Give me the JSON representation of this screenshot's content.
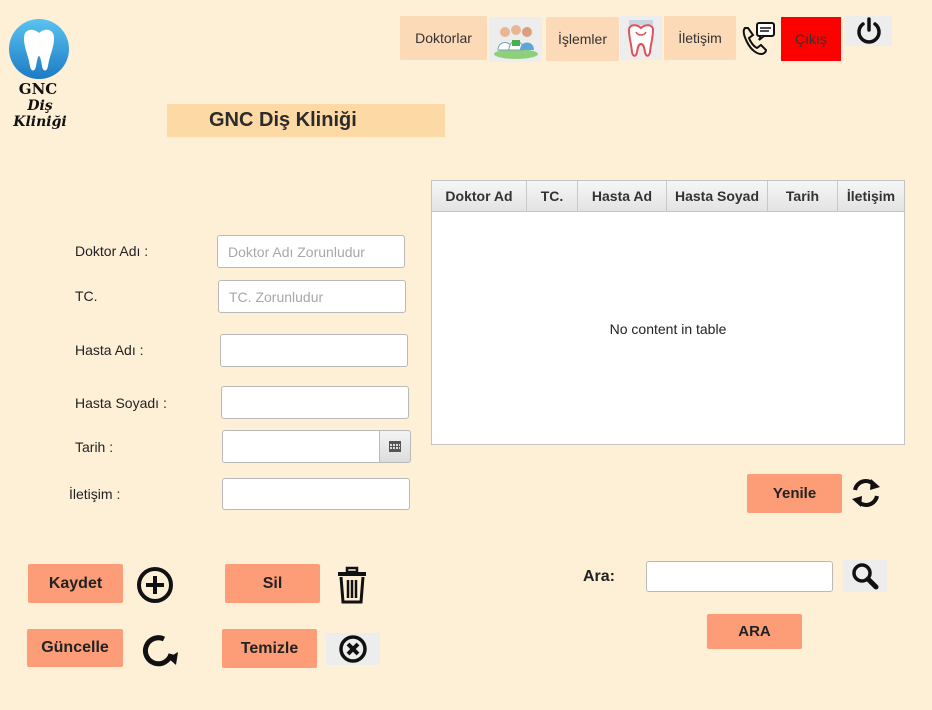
{
  "brand": {
    "name": "GNC",
    "subtitle": "Diş Kliniği"
  },
  "nav": {
    "doctors_label": "Doktorlar",
    "operations_label": "İşlemler",
    "contact_label": "İletişim",
    "exit_label": "Çıkış",
    "exit_color": "#ff0000"
  },
  "page": {
    "title": "GNC Diş Kliniği"
  },
  "form": {
    "doctor": {
      "label": "Doktor Adı :",
      "placeholder": "Doktor Adı Zorunludur",
      "value": ""
    },
    "tc": {
      "label": "TC.",
      "placeholder": "TC. Zorunludur",
      "value": ""
    },
    "patient_name": {
      "label": "Hasta Adı :",
      "value": ""
    },
    "patient_surname": {
      "label": "Hasta Soyadı :",
      "value": ""
    },
    "date": {
      "label": "Tarih :",
      "value": ""
    },
    "contact": {
      "label": "İletişim :",
      "value": ""
    }
  },
  "actions": {
    "save_label": "Kaydet",
    "delete_label": "Sil",
    "update_label": "Güncelle",
    "clear_label": "Temizle"
  },
  "table": {
    "columns": [
      "Doktor Ad",
      "TC.",
      "Hasta Ad",
      "Hasta Soyad",
      "Tarih",
      "İletişim"
    ],
    "empty_text": "No content in table"
  },
  "refresh": {
    "label": "Yenile"
  },
  "search": {
    "label": "Ara:",
    "value": "",
    "button_label": "ARA"
  },
  "colors": {
    "background": "#feefd7",
    "nav_button": "#fcd9b7",
    "action_button": "#fd9d78",
    "title_bar": "#fcd9a5"
  },
  "icons": [
    "tooth-logo-icon",
    "doctors-icon",
    "tooth-icon",
    "phone-icon",
    "power-icon",
    "calendar-icon",
    "add-circle-icon",
    "trash-icon",
    "rotate-icon",
    "close-circle-icon",
    "refresh-icon",
    "search-icon"
  ]
}
